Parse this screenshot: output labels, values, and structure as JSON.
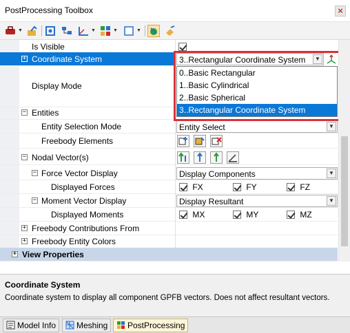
{
  "window": {
    "title": "PostProcessing Toolbox",
    "close_glyph": "×"
  },
  "toolbar": {
    "icons": [
      "tools-icon",
      "export-icon",
      "target-icon",
      "structure-icon",
      "axis-icon",
      "grid-icon",
      "box-icon",
      "deform-icon",
      "paint-icon"
    ]
  },
  "grid": {
    "rows": {
      "is_visible": {
        "label": "Is Visible"
      },
      "coordinate_system": {
        "label": "Coordinate System",
        "value": "3..Rectangular Coordinate System"
      },
      "display_mode": {
        "label": "Display Mode"
      },
      "entities": {
        "label": "Entities"
      },
      "entity_selection_mode": {
        "label": "Entity Selection Mode",
        "value": "Entity Select"
      },
      "freebody_elements": {
        "label": "Freebody Elements"
      },
      "nodal_vectors": {
        "label": "Nodal Vector(s)"
      },
      "force_vector_display": {
        "label": "Force Vector Display",
        "value": "Display Components"
      },
      "displayed_forces": {
        "label": "Displayed Forces",
        "checks": [
          "FX",
          "FY",
          "FZ"
        ]
      },
      "moment_vector_display": {
        "label": "Moment Vector Display",
        "value": "Display Resultant"
      },
      "displayed_moments": {
        "label": "Displayed Moments",
        "checks": [
          "MX",
          "MY",
          "MZ"
        ]
      },
      "freebody_contributions_from": {
        "label": "Freebody Contributions From"
      },
      "freebody_entity_colors": {
        "label": "Freebody Entity Colors"
      },
      "view_properties": {
        "label": "View Properties"
      }
    },
    "coordinate_dropdown": {
      "options": [
        "0..Basic Rectangular",
        "1..Basic Cylindrical",
        "2..Basic Spherical",
        "3..Rectangular Coordinate System"
      ],
      "highlighted_index": 3
    }
  },
  "description": {
    "title": "Coordinate System",
    "text": "Coordinate system to display all component GPFB vectors. Does not affect resultant vectors."
  },
  "tabs": [
    {
      "label": "Model Info",
      "active": false
    },
    {
      "label": "Meshing",
      "active": false
    },
    {
      "label": "PostProcessing",
      "active": true
    }
  ],
  "colors": {
    "selection": "#0a78d7",
    "highlight_box": "#d9323a",
    "group_header": "#c8d6e9"
  }
}
